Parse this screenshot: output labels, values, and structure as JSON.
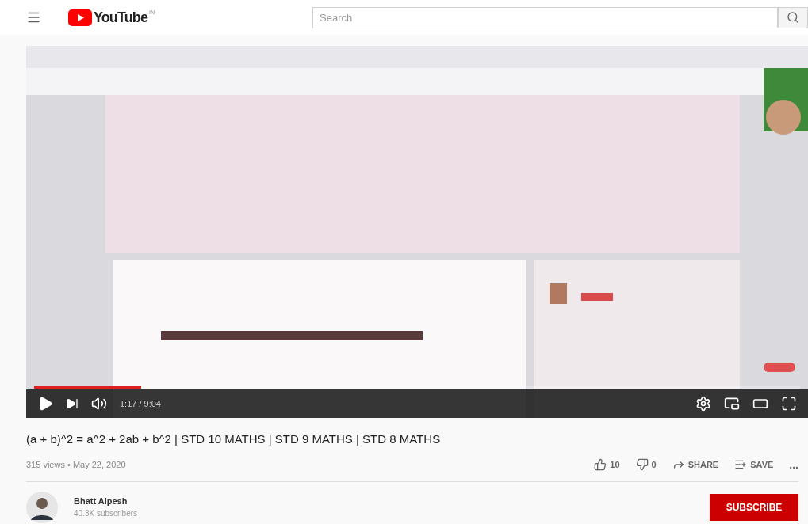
{
  "header": {
    "logo": "YouTube",
    "logo_suffix": "IN",
    "search": {
      "placeholder": "Search"
    }
  },
  "player": {
    "progress": {
      "level": 0.14
    },
    "time": "1:17 / 9:04"
  },
  "video": {
    "title": "(a + b)^2 = a^2 + 2ab + b^2 | STD 10 MATHS | STD 9 MATHS | STD 8 MATHS",
    "meta": "315 views • May 22, 2020",
    "likes": "10",
    "dislikes": "0",
    "share": "SHARE",
    "save": "SAVE",
    "more": "..."
  },
  "channel": {
    "name": "Bhatt Alpesh",
    "subscribers": "40.3K subscribers",
    "subscribe": "SUBSCRIBE"
  }
}
